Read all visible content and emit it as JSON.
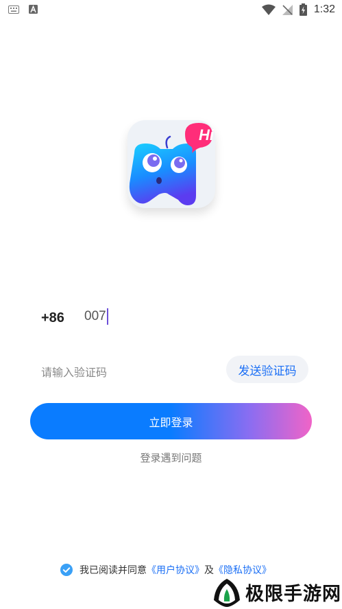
{
  "status_bar": {
    "time": "1:32",
    "left_icons": [
      "keyboard-icon",
      "text-a-icon"
    ],
    "right_icons": [
      "wifi-icon",
      "no-signal-icon",
      "battery-charging-icon"
    ]
  },
  "logo": {
    "bubble_text": "Hi",
    "colors": {
      "bubble": "#ff2d79",
      "body_top": "#19c4ff",
      "body_bottom": "#5b3cf0"
    }
  },
  "phone": {
    "country_code": "+86",
    "value": "007"
  },
  "verification": {
    "placeholder": "请输入验证码",
    "send_button": "发送验证码"
  },
  "login_button": "立即登录",
  "help_link": "登录遇到问题",
  "agreement": {
    "prefix": "我已阅读并同意",
    "user_agreement": "《用户协议》",
    "and": "及",
    "privacy_agreement": "《隐私协议》",
    "checked": true
  },
  "watermark": {
    "text": "极限手游网"
  },
  "colors": {
    "accent_blue": "#1b6ff5",
    "gradient_start": "#0a7cff",
    "gradient_end": "#f064c7",
    "cursor": "#6c4fd8"
  }
}
